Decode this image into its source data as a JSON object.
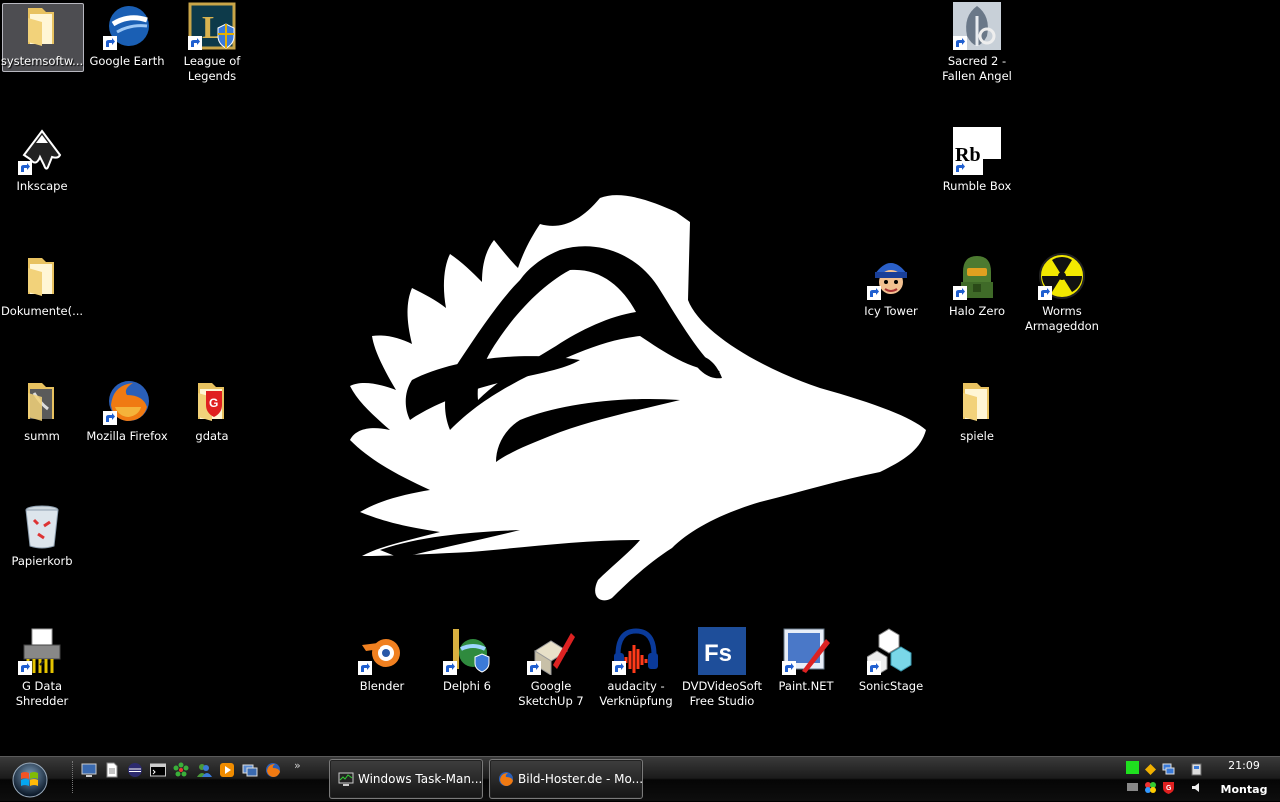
{
  "desktop": {
    "icons": {
      "systemsoftware": "systemsoftw...",
      "google_earth": "Google Earth",
      "league1": "League of",
      "league2": "Legends",
      "sacred1": "Sacred 2 -",
      "sacred2": "Fallen Angel",
      "inkscape": "Inkscape",
      "rumble_box": "Rumble Box",
      "dokumente": "Dokumente(...",
      "icy_tower": "Icy Tower",
      "halo_zero": "Halo Zero",
      "worms1": "Worms",
      "worms2": "Armageddon",
      "summ": "summ",
      "firefox": "Mozilla Firefox",
      "gdata": "gdata",
      "spiele": "spiele",
      "papierkorb": "Papierkorb",
      "shredder1": "G Data",
      "shredder2": "Shredder",
      "blender": "Blender",
      "delphi": "Delphi 6",
      "sketchup1": "Google",
      "sketchup2": "SketchUp 7",
      "audacity1": "audacity -",
      "audacity2": "Verknüpfung",
      "dvd1": "DVDVideoSoft",
      "dvd2": "Free Studio",
      "paintnet": "Paint.NET",
      "sonicstage": "SonicStage",
      "rumble_logo": "Rb",
      "dvd_logo": "Fs"
    }
  },
  "taskbar": {
    "tasks": [
      {
        "label": "Windows Task-Man..."
      },
      {
        "label": "Bild-Hoster.de - Mo..."
      }
    ],
    "quicklaunch_chevron": "»",
    "clock": {
      "time": "21:09",
      "day": "Montag"
    }
  },
  "colors": {
    "accent": "#3a7bd5",
    "wolf": "#ffffff",
    "background": "#000000"
  }
}
